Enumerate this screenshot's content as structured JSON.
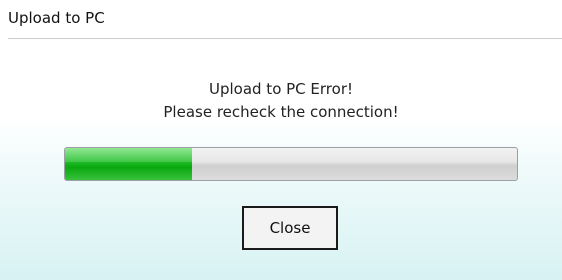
{
  "window": {
    "title": "Upload to PC"
  },
  "message": {
    "line1": "Upload to PC Error!",
    "line2": "Please recheck the connection!"
  },
  "progress": {
    "fraction": 0.28,
    "fill_color": "#19b81f",
    "track_color": "#dcdcdc"
  },
  "buttons": {
    "close_label": "Close"
  }
}
